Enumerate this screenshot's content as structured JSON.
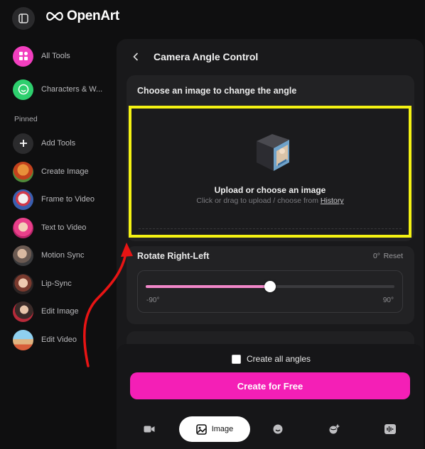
{
  "app": {
    "brand": "OpenArt"
  },
  "colors": {
    "accent_pink": "#f41fb6",
    "highlight_yellow": "#f4f213",
    "slider_fill": "#f187c9",
    "annotation_red": "#e81414"
  },
  "sidebar": {
    "pinned_label": "Pinned",
    "items": [
      {
        "label": "All Tools",
        "icon": "grid-icon"
      },
      {
        "label": "Characters & W...",
        "icon": "smiley-icon"
      },
      {
        "label": "Add Tools",
        "icon": "plus-icon"
      },
      {
        "label": "Create Image",
        "icon": "thumbnail-create-image"
      },
      {
        "label": "Frame to Video",
        "icon": "thumbnail-frame-to-video"
      },
      {
        "label": "Text to Video",
        "icon": "thumbnail-text-to-video"
      },
      {
        "label": "Motion Sync",
        "icon": "thumbnail-motion-sync"
      },
      {
        "label": "Lip-Sync",
        "icon": "thumbnail-lip-sync"
      },
      {
        "label": "Edit Image",
        "icon": "thumbnail-edit-image"
      },
      {
        "label": "Edit Video",
        "icon": "thumbnail-edit-video"
      }
    ]
  },
  "panel": {
    "title": "Camera Angle Control",
    "upload": {
      "card_title": "Choose an image to change the angle",
      "title": "Upload or choose an image",
      "subtitle": "Click or drag to upload / choose from",
      "history_link": "History"
    },
    "rotate": {
      "title": "Rotate Right-Left",
      "value": "0°",
      "reset": "Reset",
      "min_label": "-90°",
      "max_label": "90°",
      "min": -90,
      "max": 90,
      "current": 0
    },
    "create_all_angles": "Create all angles",
    "create_button": "Create for Free",
    "mode_tabs": [
      {
        "icon": "video-camera-icon",
        "label": ""
      },
      {
        "icon": "image-icon",
        "label": "Image",
        "active": true
      },
      {
        "icon": "face-icon",
        "label": ""
      },
      {
        "icon": "sparkle-globe-icon",
        "label": ""
      },
      {
        "icon": "audio-wave-icon",
        "label": ""
      }
    ]
  }
}
